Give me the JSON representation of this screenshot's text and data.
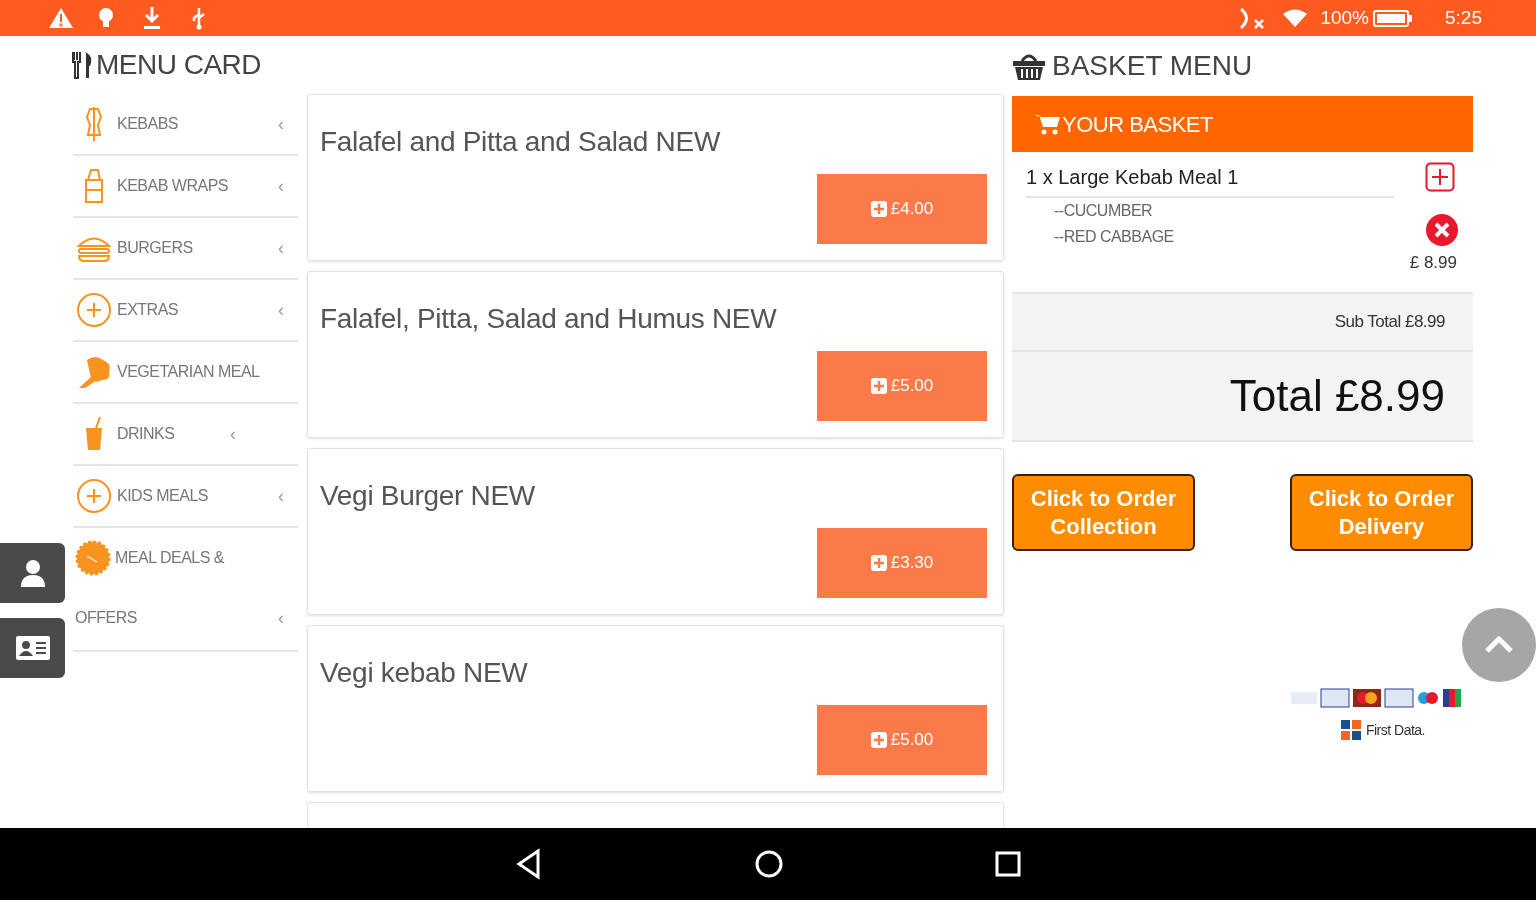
{
  "status_bar": {
    "battery_text": "100%",
    "time": "5:25"
  },
  "menu_card": {
    "title": "MENU CARD",
    "categories": [
      {
        "lines": [
          "KEBABS"
        ],
        "kind": "kebab",
        "chevron_text": "‹"
      },
      {
        "lines": [
          "KEBAB WRAPS"
        ],
        "kind": "wrap",
        "chevron_text": "‹"
      },
      {
        "lines": [
          "BURGERS"
        ],
        "kind": "burger",
        "chevron_text": "‹"
      },
      {
        "lines": [
          "EXTRAS"
        ],
        "kind": "plus",
        "chevron_text": "‹"
      },
      {
        "lines": [
          "VEGETARIAN MEAL"
        ],
        "kind": "broccoli"
      },
      {
        "lines": [
          "DRINKS"
        ],
        "kind": "drink",
        "chevron_text": "‹"
      },
      {
        "lines": [
          "KIDS MEALS"
        ],
        "kind": "plus",
        "chevron_text": "‹"
      },
      {
        "lines": [
          "MEAL DEALS &",
          "OFFERS"
        ],
        "kind": "badge",
        "chevron_text": "‹"
      }
    ],
    "items": [
      {
        "name": "Falafel and Pitta and Salad NEW",
        "price": "£4.00"
      },
      {
        "name": "Falafel, Pitta, Salad and Humus NEW",
        "price": "£5.00"
      },
      {
        "name": "Vegi Burger NEW",
        "price": "£3.30"
      },
      {
        "name": "Vegi kebab NEW",
        "price": "£5.00"
      }
    ]
  },
  "basket": {
    "title": "BASKET MENU",
    "header": "YOUR BASKET",
    "lines": [
      {
        "title": "1 x Large Kebab Meal 1",
        "options": [
          "--CUCUMBER",
          "--RED CABBAGE"
        ],
        "price": "£ 8.99"
      }
    ],
    "subtotal": "Sub Total £8.99",
    "total": "Total £8.99",
    "buttons": [
      "Click to Order Collection",
      "Click to Order Delivery"
    ],
    "payment_provider": "First Data."
  }
}
